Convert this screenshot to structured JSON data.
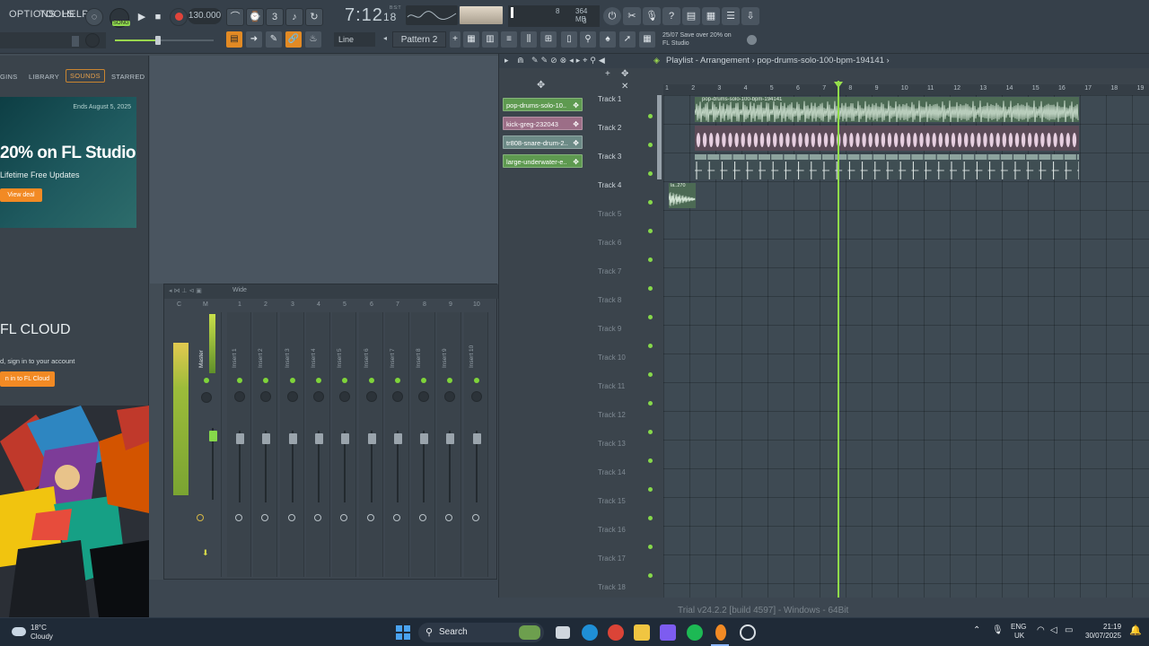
{
  "menu": {
    "options": "OPTIONS",
    "tools": "TOOLS",
    "help": "HELP"
  },
  "transport": {
    "song_mode": "SONG",
    "bpm": "130.000",
    "time_main": "7:12",
    "time_sub": "18",
    "time_sig": "B:S:T"
  },
  "cpu": {
    "memory": "364 MB",
    "cpu_value": "8",
    "poly": "3"
  },
  "toolbar2": {
    "snap": "Line",
    "pattern": "Pattern 2",
    "hint_line1": "25/07  Save over 20% on",
    "hint_line2": "FL Studio"
  },
  "browser": {
    "tabs": [
      "GINS",
      "LIBRARY",
      "SOUNDS",
      "STARRED"
    ],
    "promo": {
      "date": "Ends August 5, 2025",
      "title": "20% on FL Studio",
      "subtitle": "Lifetime Free Updates",
      "button": "View deal"
    },
    "cloud": {
      "title": "FL CLOUD",
      "subtitle": "d, sign in to your account",
      "button": "n in to FL Cloud"
    }
  },
  "mixer": {
    "title": "Wide",
    "master": "Master",
    "numbers": [
      "C",
      "M",
      "1",
      "2",
      "3",
      "4",
      "5",
      "6",
      "7",
      "8",
      "9",
      "10"
    ],
    "inserts": [
      "Insert 1",
      "Insert 2",
      "Insert 3",
      "Insert 4",
      "Insert 5",
      "Insert 6",
      "Insert 7",
      "Insert 8",
      "Insert 9",
      "Insert 10"
    ]
  },
  "playlist": {
    "title": "Playlist - Arrangement › pop-drums-solo-100-bpm-194141 ›",
    "clip_list": [
      {
        "name": "pop-drums-solo-10..",
        "color": "#5e9a50"
      },
      {
        "name": "kick-greg-232043",
        "color": "#9c6e87"
      },
      {
        "name": "tr808-snare-drum-2..",
        "color": "#6c8a86"
      },
      {
        "name": "large-underwater-e..",
        "color": "#5e9a50"
      }
    ],
    "tracks": [
      "Track 1",
      "Track 2",
      "Track 3",
      "Track 4",
      "Track 5",
      "Track 6",
      "Track 7",
      "Track 8",
      "Track 9",
      "Track 10",
      "Track 11",
      "Track 12",
      "Track 13",
      "Track 14",
      "Track 15",
      "Track 16",
      "Track 17",
      "Track 18"
    ],
    "ruler": [
      "1",
      "2",
      "3",
      "4",
      "5",
      "6",
      "7",
      "8",
      "9",
      "10",
      "11",
      "12",
      "13",
      "14",
      "15",
      "16",
      "17",
      "18",
      "19"
    ],
    "clip1_label": "pop-drums-solo-100-bpm-194141",
    "clip4_label": "la..270"
  },
  "status": {
    "version": "Trial v24.2.2 [build 4597] - Windows - 64Bit"
  },
  "taskbar": {
    "temp": "18°C",
    "weather": "Cloudy",
    "search": "Search",
    "lang1": "ENG",
    "lang2": "UK",
    "time": "21:19",
    "date": "30/07/2025"
  },
  "colors": {
    "accent": "#f28a24",
    "playhead": "#8fdc4a",
    "audio_green": "#5e9a50",
    "kick_pink": "#9c6e87"
  }
}
